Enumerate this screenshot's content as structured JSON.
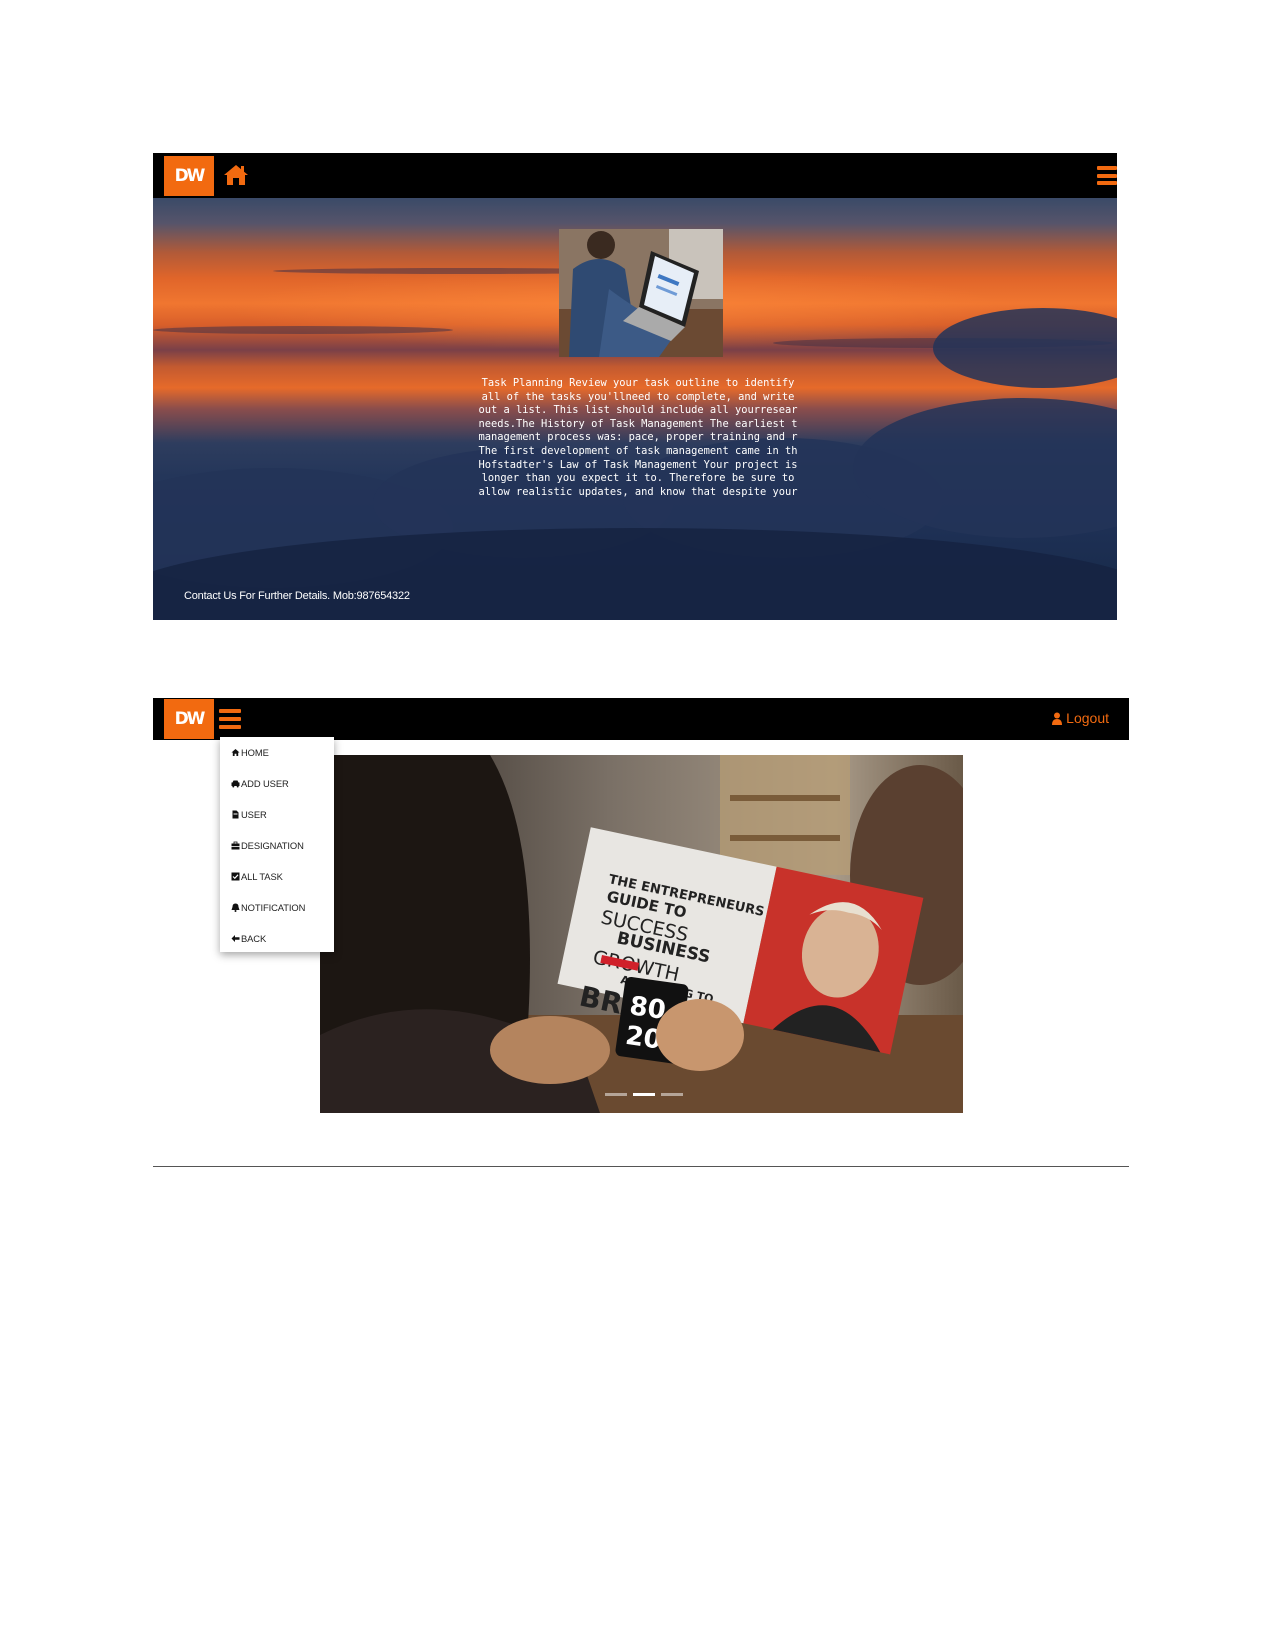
{
  "screen1": {
    "logo_text": "DW",
    "home_icon": "home-icon",
    "menu_icon": "hamburger-icon",
    "hero_image": "person-with-laptop",
    "description": "Task Planning Review your task outline to identify all of the tasks you'llneed to complete, and write out a list. This list should include all yourresear needs.The History of Task Management The earliest t management process was: pace, proper training and r The first development of task management came in th Hofstadter's Law of Task Management Your project is longer than you expect it to. Therefore be sure to allow realistic updates, and know that despite your",
    "contact": "Contact Us For Further Details. Mob:987654322"
  },
  "screen2": {
    "logo_text": "DW",
    "menu_icon": "hamburger-icon",
    "logout_label": "Logout",
    "logout_icon": "user-icon",
    "menu": [
      {
        "label": "HOME",
        "icon": "home-icon"
      },
      {
        "label": "ADD USER",
        "icon": "car-icon"
      },
      {
        "label": "USER",
        "icon": "file-icon"
      },
      {
        "label": "DESIGNATION",
        "icon": "briefcase-icon"
      },
      {
        "label": "ALL TASK",
        "icon": "check-square-icon"
      },
      {
        "label": "NOTIFICATION",
        "icon": "bell-icon"
      },
      {
        "label": "BACK",
        "icon": "arrow-left-icon"
      }
    ],
    "carousel": {
      "image": "person-reading-magazine-with-coffee",
      "magazine_lines": [
        "THE ENTREPRENEURS",
        "GUIDE TO",
        "SUCCESS",
        "BUSINESS",
        "GROWTH",
        "ACCORDING TO",
        "BRA"
      ],
      "mug_text": [
        "80",
        "20"
      ],
      "slides": 3,
      "active_slide": 2
    }
  },
  "colors": {
    "accent": "#f26a10",
    "bar": "#000000"
  }
}
